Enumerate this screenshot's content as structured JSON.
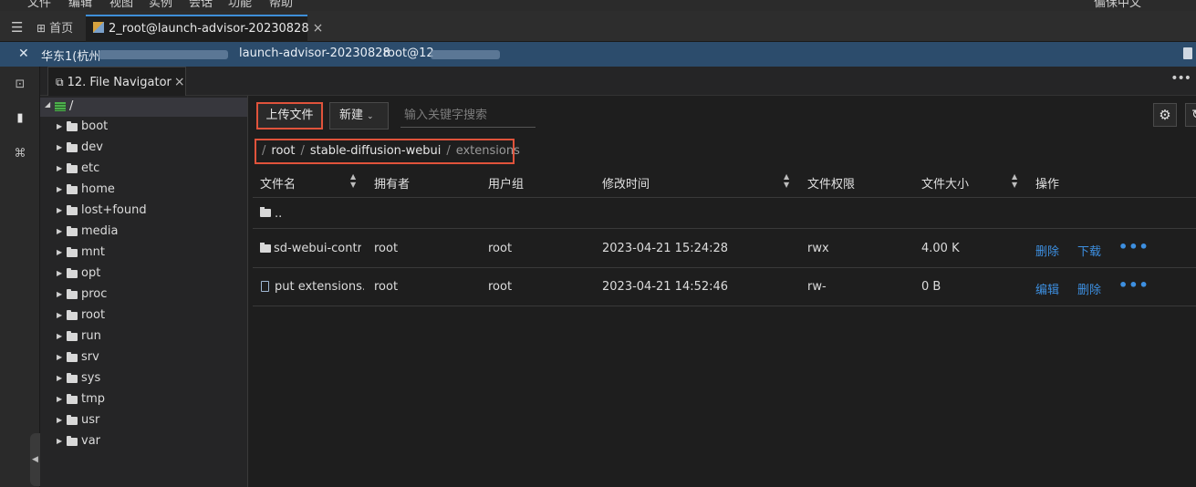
{
  "menubar": {
    "items": [
      "文件",
      "编辑",
      "视图",
      "实例",
      "会话",
      "功能",
      "帮助"
    ],
    "right": "偏保中文"
  },
  "tabs": {
    "menu_icon": "menu-icon",
    "home_label": "首页",
    "active_label": "2_root@launch-advisor-20230828"
  },
  "connection": {
    "region": "华东1(杭州",
    "instance": "launch-advisor-20230828",
    "user": "root@12"
  },
  "panel": {
    "tab_label": "12. File Navigator",
    "more": "•••"
  },
  "tree": {
    "root_label": "/",
    "items": [
      "boot",
      "dev",
      "etc",
      "home",
      "lost+found",
      "media",
      "mnt",
      "opt",
      "proc",
      "root",
      "run",
      "srv",
      "sys",
      "tmp",
      "usr",
      "var"
    ]
  },
  "toolbar": {
    "upload_label": "上传文件",
    "new_label": "新建",
    "search_placeholder": "输入关键字搜索"
  },
  "breadcrumb": {
    "root_sep": "/",
    "segments": [
      "root",
      "stable-diffusion-webui"
    ],
    "current": "extensions",
    "sep": "/"
  },
  "table": {
    "headers": {
      "name": "文件名",
      "owner": "拥有者",
      "group": "用户组",
      "mtime": "修改时间",
      "perm": "文件权限",
      "size": "文件大小",
      "ops": "操作"
    },
    "parent_label": "..",
    "rows": [
      {
        "name": "sd-webui-contro",
        "owner": "root",
        "group": "root",
        "mtime": "2023-04-21 15:24:28",
        "perm": "rwx",
        "size": "4.00 K",
        "action1": "删除",
        "action2": "下载",
        "more": "•••"
      },
      {
        "name": "put extensions...",
        "owner": "root",
        "group": "root",
        "mtime": "2023-04-21 14:52:46",
        "perm": "rw-",
        "size": "0 B",
        "action1": "编辑",
        "action2": "删除",
        "more": "•••"
      }
    ]
  },
  "colors": {
    "accent": "#3d8fe0",
    "highlight_border": "#e0533b",
    "connection_bar": "#2c4c6c"
  }
}
